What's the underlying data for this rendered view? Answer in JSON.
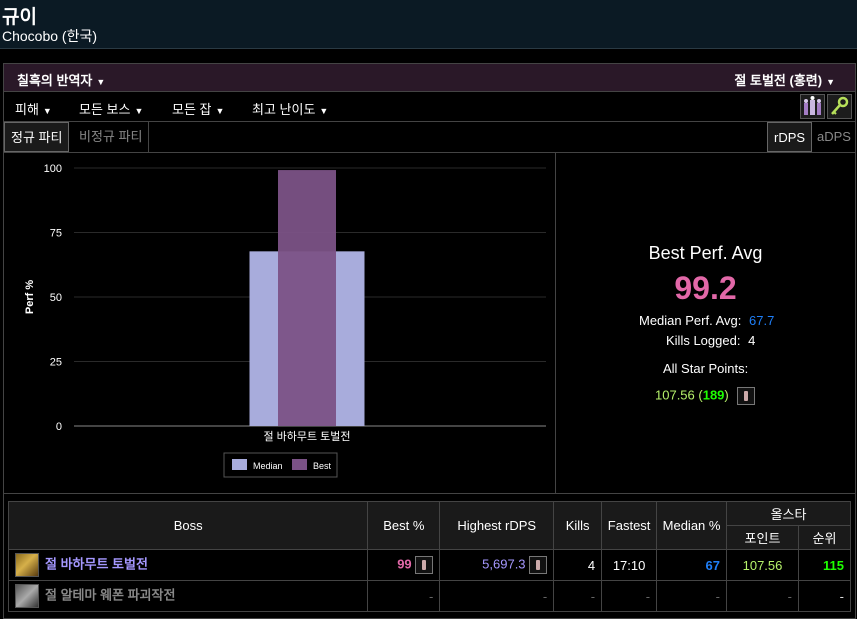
{
  "character": {
    "name": "규이",
    "server": "Chocobo (한국)"
  },
  "zone_dropdown": "칠흑의 반역자",
  "encounter_dropdown": "절 토벌전 (홍련)",
  "filters": [
    "피해",
    "모든 보스",
    "모든 잡",
    "최고 난이도"
  ],
  "party_tabs": {
    "active": "정규 파티",
    "inactive": "비정규 파티"
  },
  "metric_tabs": {
    "active": "rDPS",
    "inactive": "aDPS"
  },
  "summary": {
    "title": "Best Perf. Avg",
    "value": "99.2",
    "median_label": "Median Perf. Avg:",
    "median_value": "67.7",
    "kills_label": "Kills Logged:",
    "kills_value": "4",
    "allstar_label": "All Star Points:",
    "allstar_points": "107.56",
    "allstar_open": " (",
    "allstar_rank": "189",
    "allstar_close": ")"
  },
  "chart_data": {
    "type": "bar",
    "categories": [
      "절 바하무트 토벌전"
    ],
    "series": [
      {
        "name": "Median",
        "values": [
          67.7
        ],
        "color": "#a8acdc"
      },
      {
        "name": "Best",
        "values": [
          99.2
        ],
        "color": "#7b5286"
      }
    ],
    "ylabel": "Perf %",
    "ylim": [
      0,
      100
    ],
    "yticks": [
      0,
      25,
      50,
      75,
      100
    ],
    "legend": "bottom",
    "grid": true
  },
  "table": {
    "headers": {
      "boss": "Boss",
      "best": "Best %",
      "highest": "Highest rDPS",
      "kills": "Kills",
      "fastest": "Fastest",
      "median": "Median %",
      "allstar": "올스타",
      "points": "포인트",
      "rank": "순위"
    },
    "rows": [
      {
        "name": "절 바하무트 토벌전",
        "best": "99",
        "highest": "5,697.3",
        "kills": "4",
        "fastest": "17:10",
        "median": "67",
        "points": "107.56",
        "rank": "115"
      },
      {
        "name": "절 알테마 웨폰 파괴작전",
        "best": "-",
        "highest": "-",
        "kills": "-",
        "fastest": "-",
        "median": "-",
        "points": "-",
        "rank": "-"
      }
    ]
  },
  "colors": {
    "header_bg": "#0b1a24",
    "zone_bar": "#2a1828",
    "pink": "#e268a8",
    "blue": "#1f7ff8",
    "lime": "#b6f26b",
    "green": "#1eff00",
    "purple": "#a598ff"
  }
}
